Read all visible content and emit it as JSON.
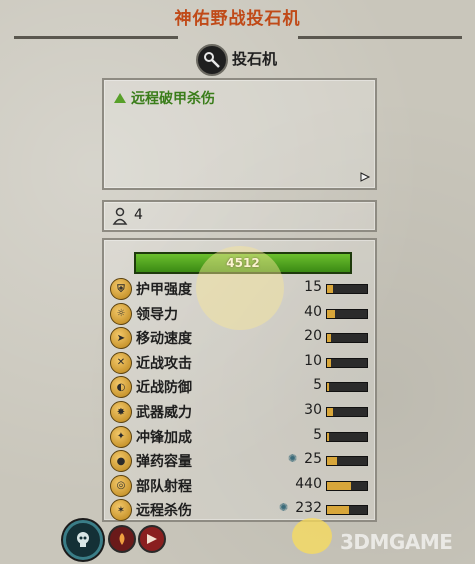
{
  "header": {
    "title": "神佑野战投石机"
  },
  "unit": {
    "name": "投石机",
    "icon": "catapult-icon"
  },
  "ability": {
    "label": "远程破甲杀伤",
    "icon": "green-triangle-icon",
    "expand_icon": "expand-arrow-icon"
  },
  "unit_count": {
    "icon": "soldier-icon",
    "value": "4"
  },
  "health": {
    "value": "4512",
    "fill_fraction": 1.0,
    "color": "#4a9a1e"
  },
  "stats": [
    {
      "label": "护甲强度",
      "value": "15",
      "bar": 0.15,
      "icon": "armor-icon"
    },
    {
      "label": "领导力",
      "value": "40",
      "bar": 0.2,
      "icon": "leadership-icon"
    },
    {
      "label": "移动速度",
      "value": "20",
      "bar": 0.1,
      "icon": "speed-icon"
    },
    {
      "label": "近战攻击",
      "value": "10",
      "bar": 0.1,
      "icon": "melee-attack-icon"
    },
    {
      "label": "近战防御",
      "value": "5",
      "bar": 0.05,
      "icon": "melee-defence-icon"
    },
    {
      "label": "武器威力",
      "value": "30",
      "bar": 0.15,
      "icon": "weapon-strength-icon"
    },
    {
      "label": "冲锋加成",
      "value": "5",
      "bar": 0.05,
      "icon": "charge-bonus-icon"
    },
    {
      "label": "弹药容量",
      "value": "25",
      "bar": 0.25,
      "icon": "ammunition-icon",
      "extra_icon": "ammo-type-icon"
    },
    {
      "label": "部队射程",
      "value": "440",
      "bar": 0.6,
      "icon": "range-icon"
    },
    {
      "label": "远程杀伤",
      "value": "232",
      "bar": 0.55,
      "icon": "missile-damage-icon",
      "extra_icon": "damage-type-icon"
    }
  ],
  "bottom_icons": [
    "faction-skull-icon",
    "fire-attack-icon",
    "charge-attack-icon"
  ],
  "watermark": {
    "text": "3DMGAME"
  },
  "colors": {
    "title": "#c04a18",
    "ability": "#3a7d1a",
    "stat_bar": "#d8a63a"
  }
}
